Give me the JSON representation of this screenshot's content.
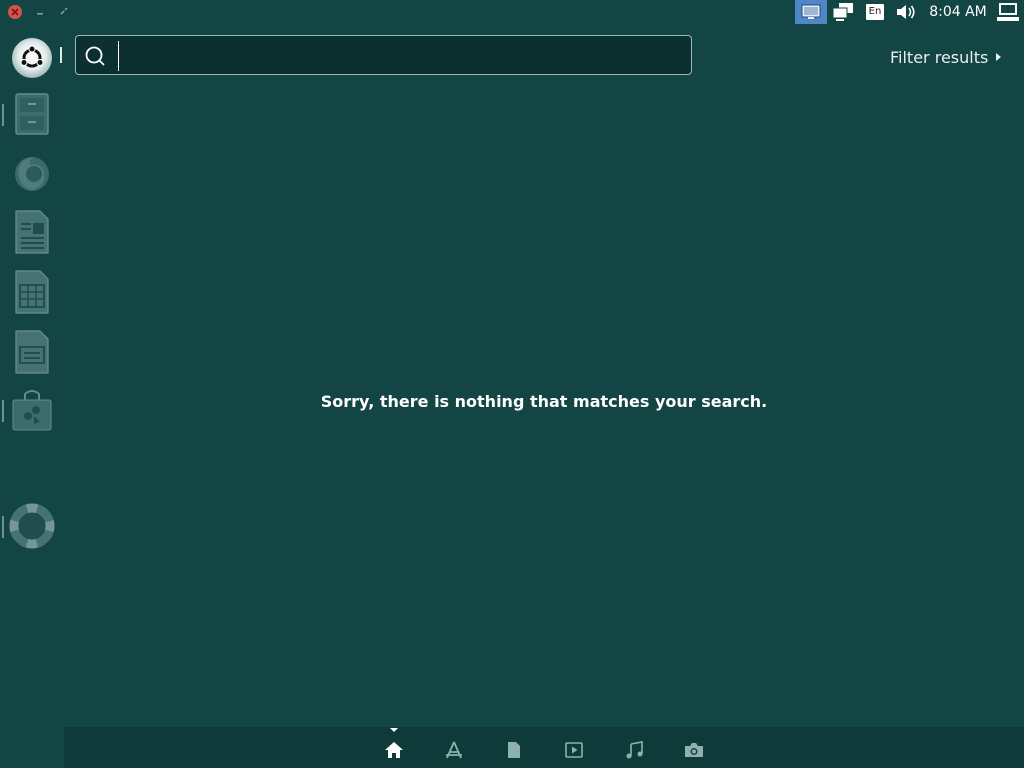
{
  "top_panel": {
    "keyboard_layout": "En",
    "clock": "8:04 AM",
    "indicators": [
      "screen-icon",
      "network-icon",
      "keyboard-layout-icon",
      "volume-icon",
      "session-icon"
    ],
    "active_indicator_color": "#4f86c6"
  },
  "window_controls": [
    "close-icon",
    "minimize-icon",
    "maximize-icon"
  ],
  "launcher": {
    "items": [
      {
        "name": "dash-home",
        "icon": "ubuntu-logo-icon"
      },
      {
        "name": "files",
        "icon": "file-cabinet-icon"
      },
      {
        "name": "firefox",
        "icon": "firefox-icon"
      },
      {
        "name": "libreoffice-writer",
        "icon": "writer-document-icon"
      },
      {
        "name": "libreoffice-calc",
        "icon": "calc-spreadsheet-icon"
      },
      {
        "name": "libreoffice-impress",
        "icon": "impress-presentation-icon"
      },
      {
        "name": "software-center",
        "icon": "shopping-bag-icon"
      },
      {
        "name": "help",
        "icon": "lifebuoy-icon"
      }
    ]
  },
  "dash": {
    "search": {
      "value": "",
      "placeholder": ""
    },
    "filter_results_label": "Filter results",
    "empty_message": "Sorry, there is nothing that matches your search."
  },
  "lens_bar": {
    "lenses": [
      "home-icon",
      "applications-icon",
      "files-icon",
      "video-icon",
      "music-icon",
      "photo-icon"
    ],
    "active": "home-icon"
  },
  "colors": {
    "background": "#134545",
    "lens_bar": "#0f3a3a",
    "close_button": "#d9534a"
  }
}
